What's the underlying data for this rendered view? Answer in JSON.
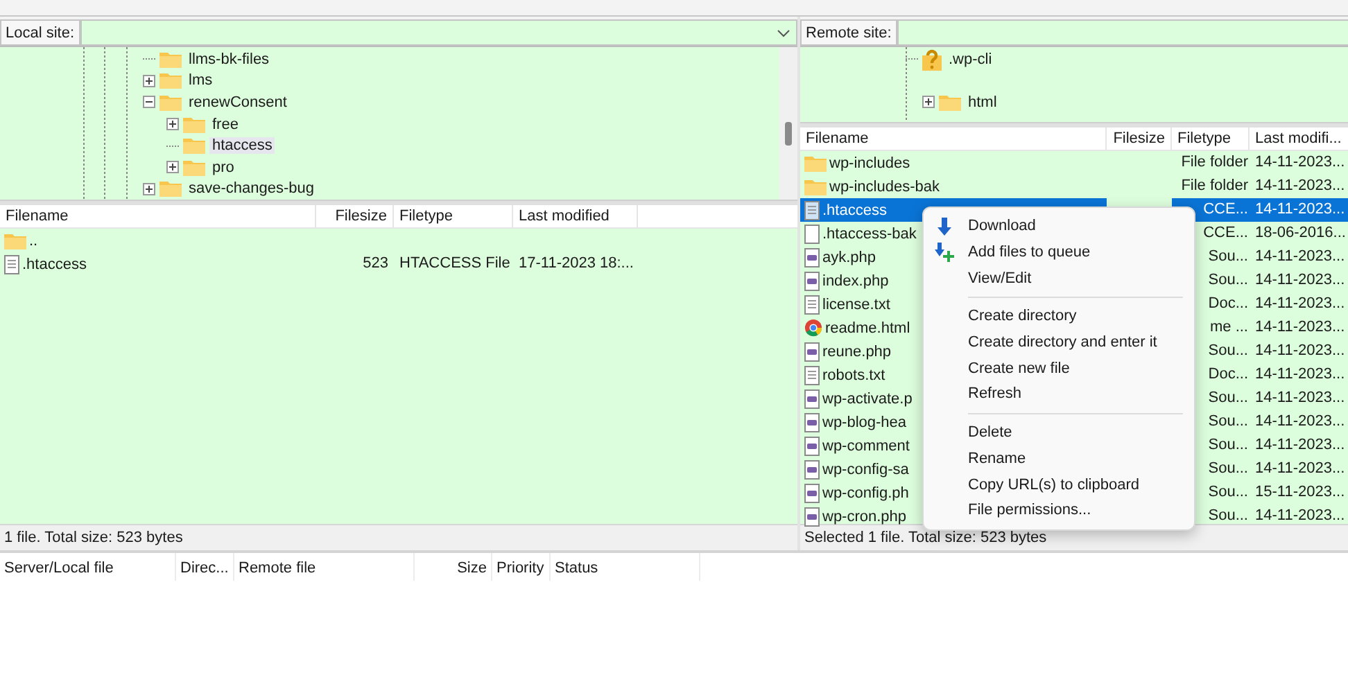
{
  "local": {
    "site_label": "Local site:",
    "tree": [
      {
        "label": "llms-bk-files",
        "kind": "leaf",
        "selected": false
      },
      {
        "label": "lms",
        "kind": "branch",
        "expanded": false,
        "selected": false
      },
      {
        "label": "renewConsent",
        "kind": "branch",
        "expanded": true,
        "selected": false,
        "children": [
          {
            "label": "free",
            "kind": "branch",
            "expanded": false,
            "selected": false
          },
          {
            "label": "htaccess",
            "kind": "leaf",
            "selected": true
          },
          {
            "label": "pro",
            "kind": "branch",
            "expanded": false,
            "selected": false
          }
        ]
      },
      {
        "label": "save-changes-bug",
        "kind": "branch",
        "expanded": false,
        "selected": false
      }
    ],
    "columns": [
      "Filename",
      "Filesize",
      "Filetype",
      "Last modified"
    ],
    "rows": [
      {
        "kind": "parent",
        "name": "..",
        "size": "",
        "type": "",
        "modified": ""
      },
      {
        "kind": "text",
        "name": ".htaccess",
        "size": "523",
        "type": "HTACCESS File",
        "modified": "17-11-2023 18:..."
      }
    ],
    "status": "1 file. Total size: 523 bytes"
  },
  "remote": {
    "site_label": "Remote site:",
    "tree": [
      {
        "label": ".wp-cli",
        "kind": "unknown-leaf"
      },
      {
        "label": "html",
        "kind": "folder-branch",
        "expanded": false
      }
    ],
    "columns": [
      "Filename",
      "Filesize",
      "Filetype",
      "Last modifi..."
    ],
    "rows": [
      {
        "kind": "folder",
        "name": "wp-includes",
        "type": "File folder",
        "modified": "14-11-2023...",
        "selected": false
      },
      {
        "kind": "folder",
        "name": "wp-includes-bak",
        "type": "File folder",
        "modified": "14-11-2023...",
        "selected": false
      },
      {
        "kind": "doc",
        "name": ".htaccess",
        "type": "CCE...",
        "modified": "14-11-2023...",
        "selected": true
      },
      {
        "kind": "blank",
        "name": ".htaccess-bak",
        "type": "CCE...",
        "modified": "18-06-2016...",
        "selected": false
      },
      {
        "kind": "php",
        "name": "ayk.php",
        "type": "Sou...",
        "modified": "14-11-2023...",
        "selected": false
      },
      {
        "kind": "php",
        "name": "index.php",
        "type": "Sou...",
        "modified": "14-11-2023...",
        "selected": false
      },
      {
        "kind": "text",
        "name": "license.txt",
        "type": "Doc...",
        "modified": "14-11-2023...",
        "selected": false
      },
      {
        "kind": "browser",
        "name": "readme.html",
        "type": "me ...",
        "modified": "14-11-2023...",
        "selected": false
      },
      {
        "kind": "php",
        "name": "reune.php",
        "type": "Sou...",
        "modified": "14-11-2023...",
        "selected": false
      },
      {
        "kind": "text",
        "name": "robots.txt",
        "type": "Doc...",
        "modified": "14-11-2023...",
        "selected": false
      },
      {
        "kind": "php",
        "name": "wp-activate.p",
        "type": "Sou...",
        "modified": "14-11-2023...",
        "selected": false
      },
      {
        "kind": "php",
        "name": "wp-blog-hea",
        "type": "Sou...",
        "modified": "14-11-2023...",
        "selected": false
      },
      {
        "kind": "php",
        "name": "wp-comment",
        "type": "Sou...",
        "modified": "14-11-2023...",
        "selected": false
      },
      {
        "kind": "php",
        "name": "wp-config-sa",
        "type": "Sou...",
        "modified": "14-11-2023...",
        "selected": false
      },
      {
        "kind": "php",
        "name": "wp-config.ph",
        "type": "Sou...",
        "modified": "15-11-2023...",
        "selected": false
      },
      {
        "kind": "php",
        "name": "wp-cron.php",
        "type": "Sou...",
        "modified": "14-11-2023...",
        "selected": false
      }
    ],
    "status": "Selected 1 file. Total size: 523 bytes"
  },
  "context_menu": [
    {
      "kind": "download",
      "label": "Download"
    },
    {
      "kind": "queue",
      "label": "Add files to queue"
    },
    {
      "kind": "plain",
      "label": "View/Edit"
    },
    {
      "kind": "separator"
    },
    {
      "kind": "plain",
      "label": "Create directory"
    },
    {
      "kind": "plain",
      "label": "Create directory and enter it"
    },
    {
      "kind": "plain",
      "label": "Create new file"
    },
    {
      "kind": "plain",
      "label": "Refresh"
    },
    {
      "kind": "separator"
    },
    {
      "kind": "plain",
      "label": "Delete"
    },
    {
      "kind": "plain",
      "label": "Rename"
    },
    {
      "kind": "plain",
      "label": "Copy URL(s) to clipboard"
    },
    {
      "kind": "plain",
      "label": "File permissions..."
    }
  ],
  "queue_columns": [
    "Server/Local file",
    "Direc...",
    "Remote file",
    "Size",
    "Priority",
    "Status"
  ]
}
